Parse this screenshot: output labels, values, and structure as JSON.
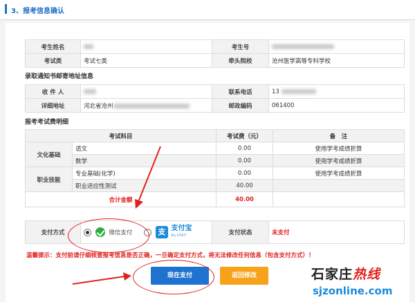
{
  "header": {
    "title": "3、报考信息确认"
  },
  "info": {
    "name_label": "考生姓名",
    "exam_no_label": "考生号",
    "category_label": "考试类",
    "category_value": "考试七类",
    "school_label": "牵头院校",
    "school_value": "沧州医学高等专科学校"
  },
  "address_section": {
    "title": "录取通知书邮寄地址信息",
    "recipient_label": "收 件 人",
    "phone_label": "联系电话",
    "phone_value_prefix": "13",
    "address_label": "详细地址",
    "address_value_prefix": "河北省沧州",
    "postcode_label": "邮政编码",
    "postcode_value": "061400"
  },
  "fee_section": {
    "title": "报考考试费明细",
    "headers": [
      "考试科目",
      "考试费（元）",
      "备　注"
    ],
    "groups": [
      {
        "group": "文化基础",
        "rows": [
          {
            "subject": "语文",
            "fee": "0.00",
            "note": "使用学考成绩折算"
          },
          {
            "subject": "数学",
            "fee": "0.00",
            "note": "使用学考成绩折算"
          }
        ]
      },
      {
        "group": "职业技能",
        "rows": [
          {
            "subject": "专业基础(化学)",
            "fee": "0.00",
            "note": "使用学考成绩折算"
          },
          {
            "subject": "职业适应性测试",
            "fee": "40.00",
            "note": ""
          }
        ]
      }
    ],
    "total_label": "合计金额",
    "total_value": "40.00"
  },
  "payment": {
    "method_label": "支付方式",
    "wechat_label": "微信支付",
    "alipay_cn": "支付宝",
    "alipay_en": "ALIPAY",
    "alipay_icon": "支",
    "status_label": "支付状态",
    "status_value": "未支付"
  },
  "warning": "温馨提示：支付前请仔细核查报考信息是否正确，一旦确定支付方式，将无法修改任何信息（包含支付方式）！",
  "buttons": {
    "pay": "现在支付",
    "back": "返回修改"
  },
  "watermark": {
    "line1_black": "石家庄",
    "line1_red": "热线",
    "line2": "sjzonline.com"
  },
  "colors": {
    "accent": "#1f72d0",
    "warning": "#e0201e",
    "back_button": "#f7a21b",
    "wechat": "#2aae3a",
    "alipay": "#1a8bdb"
  }
}
